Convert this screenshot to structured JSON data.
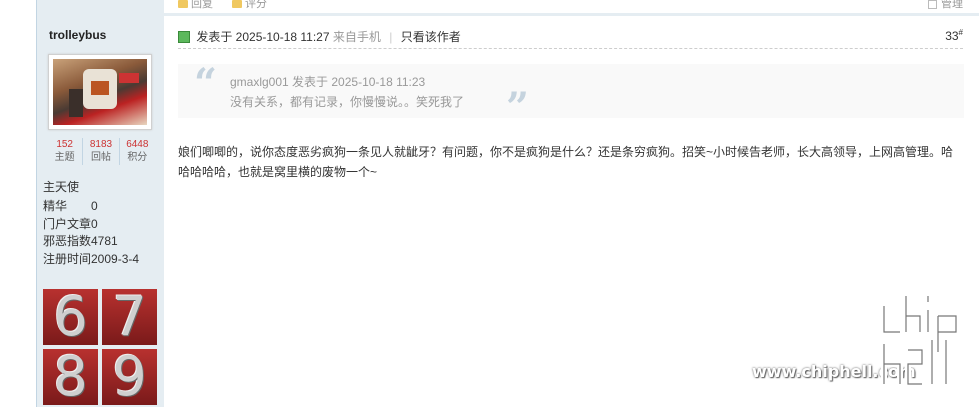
{
  "top_strip": {
    "reply_label": "回复",
    "rate_label": "评分",
    "manage_label": "管理"
  },
  "author": {
    "username": "trolleybus",
    "stats": [
      {
        "value": "152",
        "label": "主题"
      },
      {
        "value": "8183",
        "label": "回帖"
      },
      {
        "value": "6448",
        "label": "积分"
      }
    ],
    "rank": "主天使",
    "info": [
      {
        "key": "精华",
        "value": "0"
      },
      {
        "key": "门户文章",
        "value": "0"
      },
      {
        "key": "邪恶指数",
        "value": "4781"
      },
      {
        "key": "注册时间",
        "value": "2009-3-4"
      }
    ],
    "medals": [
      "6",
      "7",
      "8",
      "9"
    ]
  },
  "post": {
    "posted_at": "发表于 2025-10-18 11:27",
    "via": "来自手机",
    "only_author": "只看该作者",
    "floor": "33",
    "floor_sup": "#",
    "quote": {
      "author_line": "gmaxlg001 发表于 2025-10-18 11:23",
      "text": "没有关系，都有记录，你慢慢说。。笑死我了"
    },
    "message": "娘们唧唧的，说你态度恶劣疯狗一条见人就龇牙？有问题，你不是疯狗是什么？还是条穷疯狗。招笑~小时候告老师，长大高领导，上网高管理。哈哈哈哈哈，也就是窝里横的废物一个~"
  },
  "watermark": {
    "url": "www.chiphell.com",
    "logo_text": "chiphell"
  },
  "colors": {
    "sidebar_bg": "#e5edf2",
    "stat_number": "#cc3333",
    "quote_mark": "#c5d3de"
  }
}
